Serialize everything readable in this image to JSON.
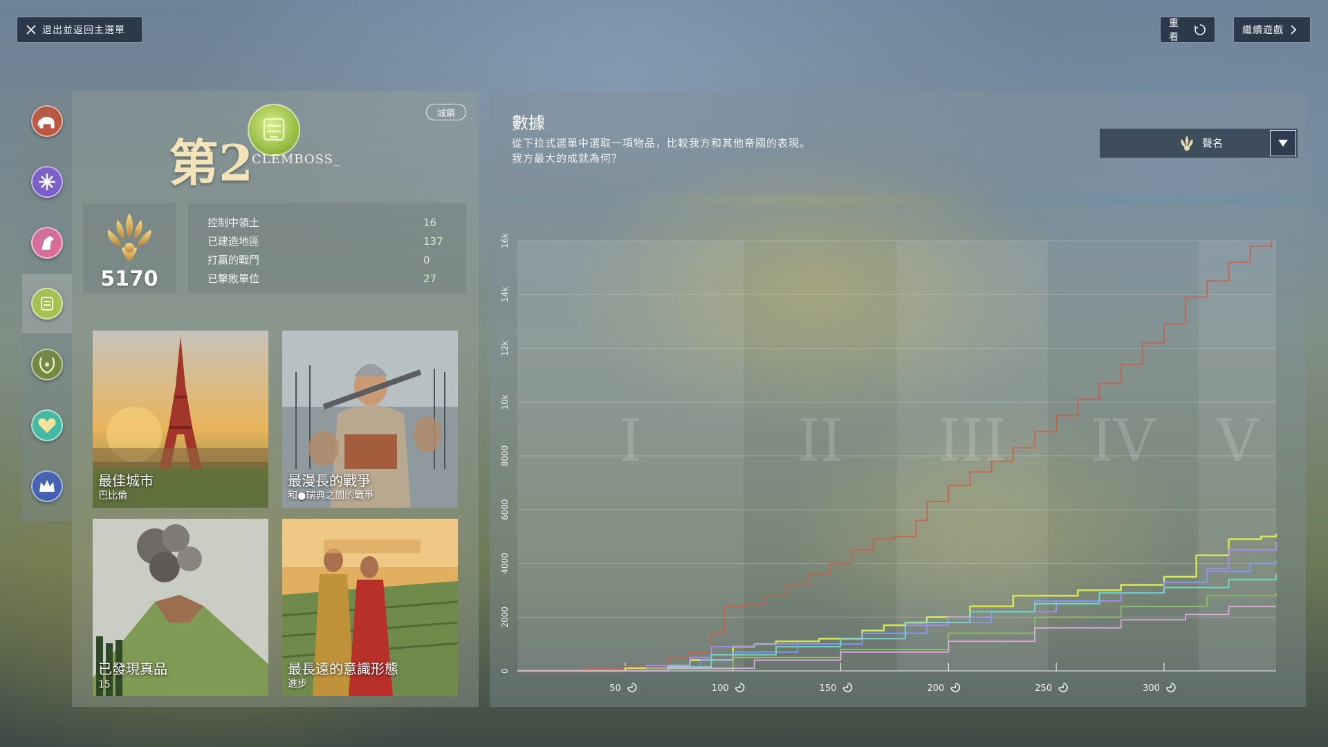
{
  "topbar": {
    "exit_label": "退出並返回主選單",
    "replay_label": "重看",
    "continue_label": "繼續遊戲"
  },
  "rail": {
    "items": [
      {
        "icon": "elephant-icon",
        "color": "#c0533c"
      },
      {
        "icon": "science-icon",
        "color": "#7e5bd0"
      },
      {
        "icon": "horse-icon",
        "color": "#e06a9a"
      },
      {
        "icon": "leader-icon",
        "color": "#a9c44a",
        "active": true
      },
      {
        "icon": "laurel-icon",
        "color": "#6f8a3e"
      },
      {
        "icon": "heart-icon",
        "color": "#3fbfa8"
      },
      {
        "icon": "crown-icon",
        "color": "#3f5fb8"
      }
    ]
  },
  "summary": {
    "rank": "第2",
    "leader_name": "CLEMBOSS_",
    "age_badge": "城鎮",
    "score": "5170",
    "stats": [
      {
        "label": "控制中領土",
        "value": "16"
      },
      {
        "label": "已建造地區",
        "value": "137"
      },
      {
        "label": "打贏的戰鬥",
        "value": "0"
      },
      {
        "label": "已擊敗單位",
        "value": "27"
      }
    ],
    "cards": [
      {
        "title": "最佳城市",
        "subtitle": "巴比倫"
      },
      {
        "title": "最漫長的戰爭",
        "subtitle": "和●瑞典之間的戰爭"
      },
      {
        "title": "已發現真品",
        "subtitle": "15"
      },
      {
        "title": "最長遠的意識形態",
        "subtitle": "進步"
      }
    ]
  },
  "header": {
    "title": "數據",
    "line1": "從下拉式選單中選取一項物品，比較我方和其他帝國的表現。",
    "line2": "我方最大的成就為何？",
    "dropdown_value": "聲名"
  },
  "colors": {
    "player": "#d9ea54",
    "purple": "#a98cff",
    "blue": "#7f9bff",
    "teal": "#6fe0d0",
    "green": "#8fbf6a",
    "pink": "#e7a8e8",
    "red": "#c7614a"
  },
  "chart_data": {
    "type": "line",
    "xlabel": "",
    "ylabel": "",
    "xlim": [
      0,
      352
    ],
    "ylim": [
      0,
      16000
    ],
    "x_ticks": [
      50,
      100,
      150,
      200,
      250,
      300
    ],
    "y_ticks": [
      0,
      2000,
      4000,
      6000,
      8000,
      10000,
      12000,
      14000,
      16000
    ],
    "y_tick_labels": [
      "0",
      "2000",
      "4000",
      "6000",
      "8000",
      "10k",
      "12k",
      "14k",
      "16k"
    ],
    "eras": [
      {
        "label": "I",
        "start": 0,
        "end": 105
      },
      {
        "label": "II",
        "start": 105,
        "end": 176
      },
      {
        "label": "III",
        "start": 176,
        "end": 246
      },
      {
        "label": "IV",
        "start": 246,
        "end": 316
      },
      {
        "label": "V",
        "start": 316,
        "end": 352
      }
    ],
    "series": [
      {
        "color_key": "red",
        "points": [
          [
            0,
            0
          ],
          [
            30,
            80
          ],
          [
            50,
            150
          ],
          [
            70,
            500
          ],
          [
            80,
            700
          ],
          [
            90,
            1400
          ],
          [
            96,
            2400
          ],
          [
            105,
            2500
          ],
          [
            115,
            2800
          ],
          [
            125,
            3200
          ],
          [
            135,
            3600
          ],
          [
            145,
            4000
          ],
          [
            155,
            4500
          ],
          [
            165,
            4900
          ],
          [
            175,
            5000
          ],
          [
            185,
            5600
          ],
          [
            190,
            6300
          ],
          [
            200,
            6900
          ],
          [
            210,
            7400
          ],
          [
            220,
            7800
          ],
          [
            230,
            8300
          ],
          [
            240,
            8900
          ],
          [
            250,
            9500
          ],
          [
            260,
            10100
          ],
          [
            270,
            10700
          ],
          [
            280,
            11400
          ],
          [
            290,
            12200
          ],
          [
            300,
            12900
          ],
          [
            310,
            13900
          ],
          [
            320,
            14500
          ],
          [
            330,
            15200
          ],
          [
            340,
            15800
          ],
          [
            350,
            16000
          ]
        ]
      },
      {
        "color_key": "player",
        "points": [
          [
            0,
            0
          ],
          [
            40,
            0
          ],
          [
            50,
            100
          ],
          [
            70,
            200
          ],
          [
            80,
            400
          ],
          [
            100,
            900
          ],
          [
            110,
            1000
          ],
          [
            120,
            1100
          ],
          [
            140,
            1200
          ],
          [
            160,
            1500
          ],
          [
            170,
            1700
          ],
          [
            180,
            1800
          ],
          [
            190,
            2000
          ],
          [
            210,
            2400
          ],
          [
            230,
            2800
          ],
          [
            260,
            3000
          ],
          [
            280,
            3200
          ],
          [
            300,
            3500
          ],
          [
            315,
            4300
          ],
          [
            330,
            4900
          ],
          [
            345,
            5000
          ],
          [
            352,
            5100
          ]
        ]
      },
      {
        "color_key": "purple",
        "points": [
          [
            0,
            0
          ],
          [
            60,
            200
          ],
          [
            80,
            500
          ],
          [
            90,
            900
          ],
          [
            110,
            1000
          ],
          [
            150,
            1200
          ],
          [
            180,
            1700
          ],
          [
            200,
            2000
          ],
          [
            220,
            2200
          ],
          [
            250,
            2600
          ],
          [
            280,
            2900
          ],
          [
            300,
            3300
          ],
          [
            320,
            3800
          ],
          [
            330,
            4500
          ],
          [
            352,
            4800
          ]
        ]
      },
      {
        "color_key": "blue",
        "points": [
          [
            0,
            0
          ],
          [
            60,
            100
          ],
          [
            85,
            400
          ],
          [
            100,
            700
          ],
          [
            130,
            1000
          ],
          [
            160,
            1400
          ],
          [
            190,
            1800
          ],
          [
            220,
            2200
          ],
          [
            240,
            2600
          ],
          [
            270,
            2900
          ],
          [
            300,
            3300
          ],
          [
            320,
            3700
          ],
          [
            340,
            4000
          ],
          [
            352,
            4100
          ]
        ]
      },
      {
        "color_key": "teal",
        "points": [
          [
            0,
            0
          ],
          [
            70,
            150
          ],
          [
            90,
            600
          ],
          [
            120,
            900
          ],
          [
            150,
            1200
          ],
          [
            180,
            1800
          ],
          [
            210,
            2200
          ],
          [
            240,
            2500
          ],
          [
            270,
            2900
          ],
          [
            300,
            3100
          ],
          [
            330,
            3400
          ],
          [
            352,
            3600
          ]
        ]
      },
      {
        "color_key": "green",
        "points": [
          [
            0,
            0
          ],
          [
            60,
            80
          ],
          [
            100,
            500
          ],
          [
            150,
            800
          ],
          [
            200,
            1400
          ],
          [
            240,
            2000
          ],
          [
            280,
            2400
          ],
          [
            320,
            2800
          ],
          [
            352,
            2900
          ]
        ]
      },
      {
        "color_key": "pink",
        "points": [
          [
            0,
            0
          ],
          [
            70,
            100
          ],
          [
            110,
            400
          ],
          [
            150,
            700
          ],
          [
            200,
            1100
          ],
          [
            240,
            1600
          ],
          [
            280,
            1900
          ],
          [
            310,
            2100
          ],
          [
            330,
            2400
          ],
          [
            352,
            2400
          ]
        ]
      }
    ]
  }
}
